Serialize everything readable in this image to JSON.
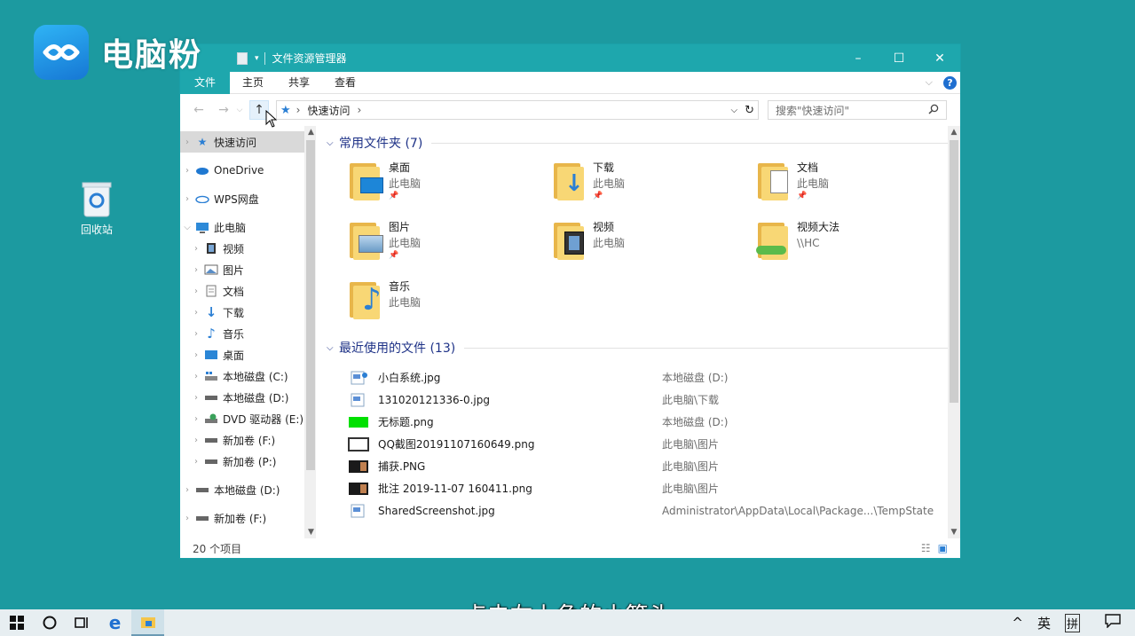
{
  "logo": {
    "text": "电脑粉",
    "icon": "logo-swirl-icon"
  },
  "desktop": {
    "recycle_bin": "回收站"
  },
  "window": {
    "title": "文件资源管理器",
    "controls": {
      "minimize": "–",
      "maximize": "☐",
      "close": "✕"
    },
    "ribbon_tabs": [
      "文件",
      "主页",
      "共享",
      "查看"
    ],
    "address": {
      "pin_icon": "pin-icon",
      "separator": "›",
      "path": "快速访问"
    },
    "search_placeholder": "搜索\"快速访问\"",
    "sidebar": [
      {
        "label": "快速访问",
        "icon": "star-pin-icon",
        "selected": true
      },
      {
        "label": "OneDrive",
        "icon": "cloud-icon"
      },
      {
        "label": "WPS网盘",
        "icon": "cloud-outline-icon"
      },
      {
        "label": "此电脑",
        "icon": "pc-icon",
        "expanded": true
      },
      {
        "label": "视频",
        "icon": "video-icon",
        "indent": true
      },
      {
        "label": "图片",
        "icon": "picture-icon",
        "indent": true
      },
      {
        "label": "文档",
        "icon": "document-icon",
        "indent": true
      },
      {
        "label": "下载",
        "icon": "download-icon",
        "indent": true
      },
      {
        "label": "音乐",
        "icon": "music-icon",
        "indent": true
      },
      {
        "label": "桌面",
        "icon": "desktop-icon",
        "indent": true
      },
      {
        "label": "本地磁盘 (C:)",
        "icon": "drive-c-icon",
        "indent": true
      },
      {
        "label": "本地磁盘 (D:)",
        "icon": "drive-icon",
        "indent": true
      },
      {
        "label": "DVD 驱动器 (E:)",
        "icon": "dvd-icon",
        "indent": true
      },
      {
        "label": "新加卷 (F:)",
        "icon": "drive-icon",
        "indent": true
      },
      {
        "label": "新加卷 (P:)",
        "icon": "drive-icon",
        "indent": true
      },
      {
        "label": "本地磁盘 (D:)",
        "icon": "drive-icon"
      },
      {
        "label": "新加卷 (F:)",
        "icon": "drive-icon"
      }
    ],
    "frequent": {
      "header": "常用文件夹 (7)",
      "folders": [
        {
          "name": "桌面",
          "sub": "此电脑",
          "pinned": true,
          "icon": "desktop-folder-icon"
        },
        {
          "name": "下载",
          "sub": "此电脑",
          "pinned": true,
          "icon": "download-folder-icon"
        },
        {
          "name": "文档",
          "sub": "此电脑",
          "pinned": true,
          "icon": "document-folder-icon"
        },
        {
          "name": "图片",
          "sub": "此电脑",
          "pinned": true,
          "icon": "picture-folder-icon"
        },
        {
          "name": "视频",
          "sub": "此电脑",
          "pinned": false,
          "icon": "video-folder-icon"
        },
        {
          "name": "视频大法",
          "sub": "\\\\HC",
          "pinned": false,
          "icon": "network-folder-icon"
        },
        {
          "name": "音乐",
          "sub": "此电脑",
          "pinned": false,
          "icon": "music-folder-icon"
        }
      ]
    },
    "recent": {
      "header": "最近使用的文件 (13)",
      "files": [
        {
          "name": "小白系统.jpg",
          "path": "本地磁盘 (D:)",
          "thumb": "jpg-file-icon",
          "color": "#5b8fd6"
        },
        {
          "name": "131020121336-0.jpg",
          "path": "此电脑\\下载",
          "thumb": "jpg-file-icon",
          "color": "#5b8fd6"
        },
        {
          "name": "无标题.png",
          "path": "本地磁盘 (D:)",
          "thumb": "green-image-thumb",
          "color": "#00e000"
        },
        {
          "name": "QQ截图20191107160649.png",
          "path": "此电脑\\图片",
          "thumb": "screenshot-thumb",
          "color": "#333333"
        },
        {
          "name": "捕获.PNG",
          "path": "此电脑\\图片",
          "thumb": "dark-image-thumb",
          "color": "#1a1a1a"
        },
        {
          "name": "批注 2019-11-07 160411.png",
          "path": "此电脑\\图片",
          "thumb": "dark-image-thumb",
          "color": "#1a1a1a"
        },
        {
          "name": "SharedScreenshot.jpg",
          "path": "Administrator\\AppData\\Local\\Package...\\TempState",
          "thumb": "jpg-file-icon",
          "color": "#5b8fd6"
        }
      ]
    },
    "status": "20 个项目"
  },
  "subtitle": "点击左上角的小箭头",
  "taskbar": {
    "ime_lang": "英",
    "ime_mode": "拼",
    "tray_up": "^"
  },
  "colors": {
    "titlebar": "#1ea7ad",
    "desktop": "#1c9aa0",
    "group_header": "#1e3287"
  }
}
